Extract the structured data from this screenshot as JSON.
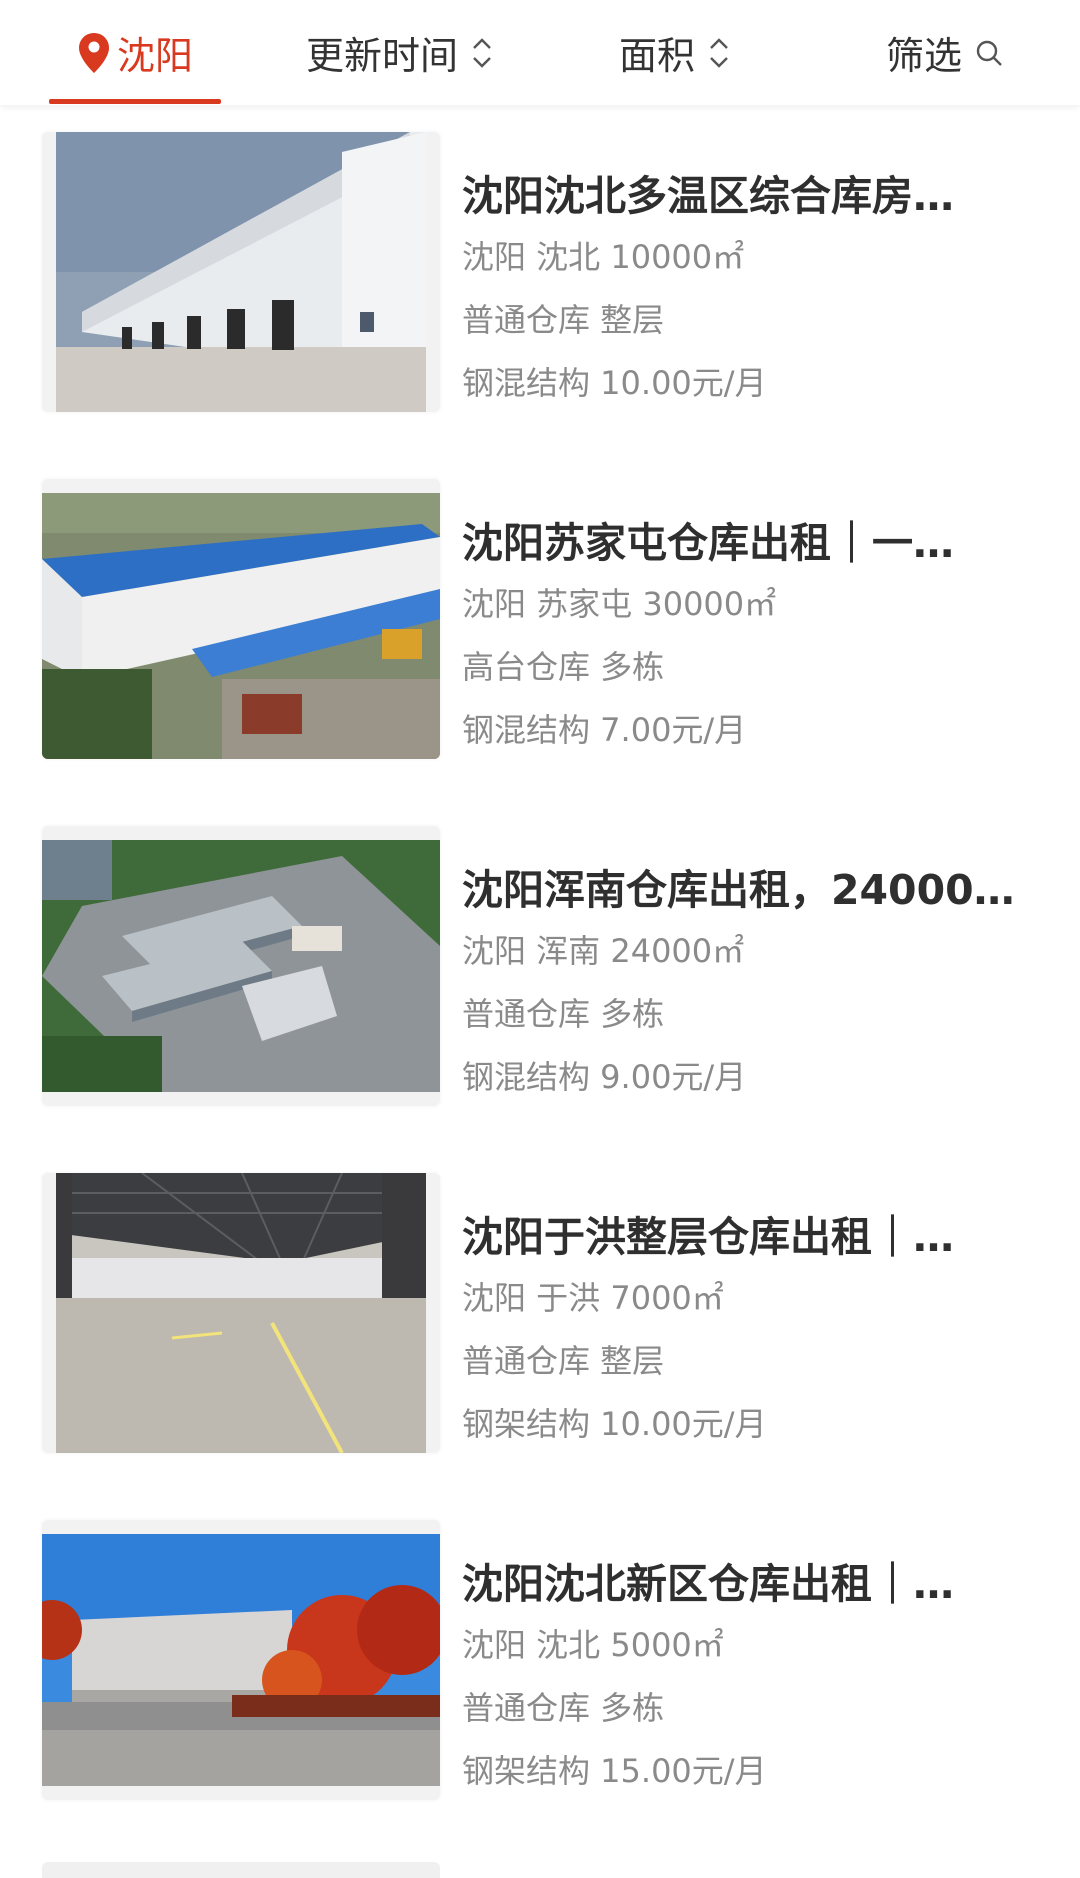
{
  "filter_bar": {
    "city": "沈阳",
    "update_time": "更新时间",
    "area": "面积",
    "filter": "筛选"
  },
  "colors": {
    "accent": "#d9391f",
    "title": "#2f2f2f",
    "meta": "#8a8a8a"
  },
  "listings": [
    {
      "title": "沈阳沈北多温区综合库房…",
      "location": "沈阳 沈北 10000㎡",
      "type": "普通仓库 整层",
      "price": "钢混结构 10.00元/月",
      "image": "white-warehouse-with-dock-doors"
    },
    {
      "title": "沈阳苏家屯仓库出租｜一…",
      "location": "沈阳 苏家屯 30000㎡",
      "type": "高台仓库 多栋",
      "price": "钢混结构 7.00元/月",
      "image": "blue-roof-warehouse-aerial"
    },
    {
      "title": "沈阳浑南仓库出租，24000…",
      "location": "沈阳 浑南 24000㎡",
      "type": "普通仓库 多栋",
      "price": "钢混结构 9.00元/月",
      "image": "warehouse-park-rendering"
    },
    {
      "title": "沈阳于洪整层仓库出租｜…",
      "location": "沈阳 于洪 7000㎡",
      "type": "普通仓库 整层",
      "price": "钢架结构 10.00元/月",
      "image": "empty-steel-frame-interior"
    },
    {
      "title": "沈阳沈北新区仓库出租｜…",
      "location": "沈阳 沈北 5000㎡",
      "type": "普通仓库 多栋",
      "price": "钢架结构 15.00元/月",
      "image": "warehouse-with-red-trees"
    }
  ]
}
